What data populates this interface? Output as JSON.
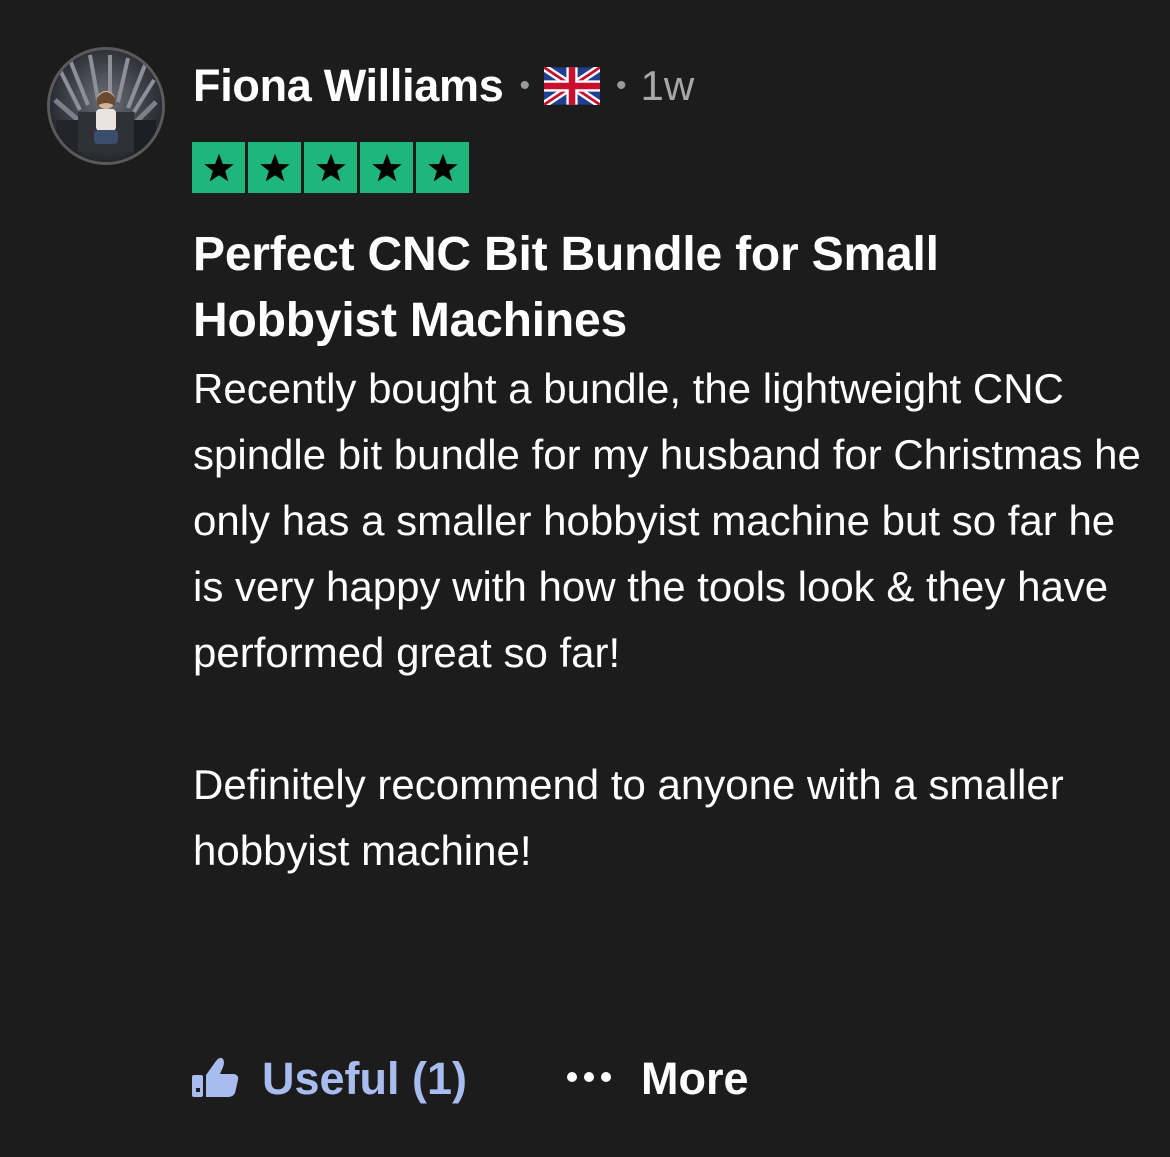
{
  "reviewer": {
    "name": "Fiona Williams",
    "separator": "•",
    "country_flag_icon": "uk-flag-icon",
    "time_ago": "1w"
  },
  "rating": {
    "stars": 5,
    "max_stars": 5,
    "star_icon": "star-icon",
    "color": "#1eb67a"
  },
  "review": {
    "title": "Perfect CNC Bit Bundle for Small Hobbyist Machines",
    "paragraphs": [
      "Recently bought a bundle, the lightweight CNC spindle bit bundle for my husband for Christmas he only has a smaller hobbyist machine but so far he is very happy with how the tools look & they have performed great so far!",
      "Definitely recommend to anyone with a smaller hobbyist machine!"
    ]
  },
  "actions": {
    "useful_icon": "thumbs-up-icon",
    "useful_label": "Useful (1)",
    "more_icon": "ellipsis-icon",
    "more_label": "More"
  },
  "colors": {
    "background": "#1c1c1c",
    "useful_accent": "#a9bcef",
    "muted_text": "#a8a8a8"
  }
}
